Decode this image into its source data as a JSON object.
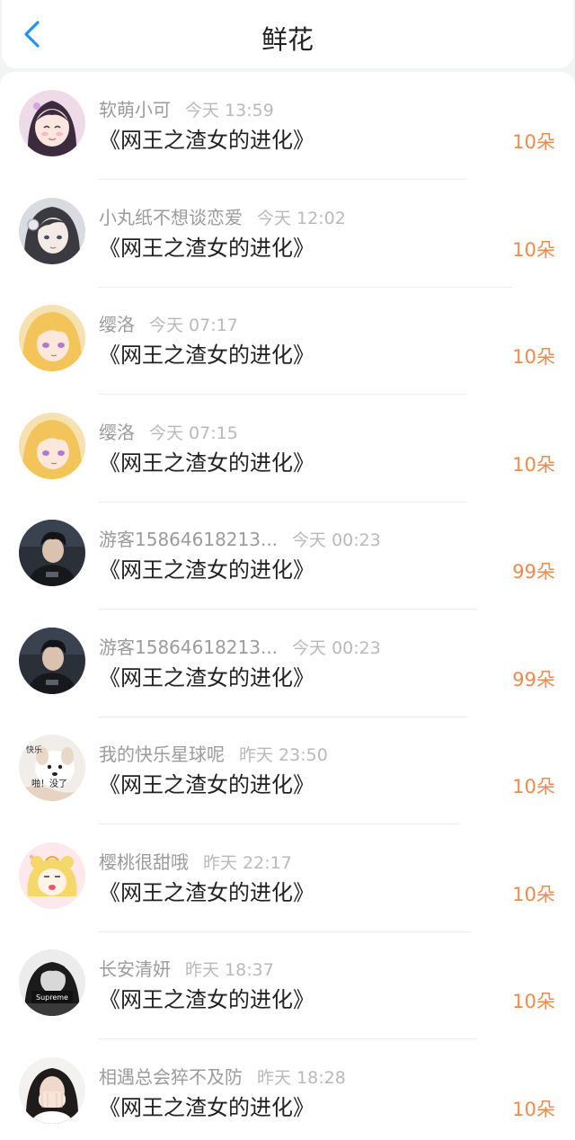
{
  "header": {
    "title": "鲜花",
    "back_icon": "chevron-left-icon",
    "accent_color": "#1e96f0"
  },
  "list": {
    "items": [
      {
        "name": "软萌小可",
        "time": "今天 13:59",
        "book": "《网王之渣女的进化》",
        "count": "10朵",
        "avatar": "anime-girl-purple"
      },
      {
        "name": "小丸纸不想谈恋爱",
        "time": "今天 12:02",
        "book": "《网王之渣女的进化》",
        "count": "10朵",
        "avatar": "anime-girl-dark-hair"
      },
      {
        "name": "缨洛",
        "time": "今天 07:17",
        "book": "《网王之渣女的进化》",
        "count": "10朵",
        "avatar": "anime-blonde"
      },
      {
        "name": "缨洛",
        "time": "今天 07:15",
        "book": "《网王之渣女的进化》",
        "count": "10朵",
        "avatar": "anime-blonde"
      },
      {
        "name": "游客15864618213...",
        "time": "今天 00:23",
        "book": "《网王之渣女的进化》",
        "count": "99朵",
        "avatar": "photo-boy-dark"
      },
      {
        "name": "游客15864618213...",
        "time": "今天 00:23",
        "book": "《网王之渣女的进化》",
        "count": "99朵",
        "avatar": "photo-boy-dark"
      },
      {
        "name": "我的快乐星球呢",
        "time": "昨天 23:50",
        "book": "《网王之渣女的进化》",
        "count": "10朵",
        "avatar": "meme-dog",
        "avatar_text_1": "快乐",
        "avatar_text_2": "啪！没了"
      },
      {
        "name": "樱桃很甜哦",
        "time": "昨天 22:17",
        "book": "《网王之渣女的进化》",
        "count": "10朵",
        "avatar": "cartoon-sailor-moon"
      },
      {
        "name": "长安清妍",
        "time": "昨天 18:37",
        "book": "《网王之渣女的进化》",
        "count": "10朵",
        "avatar": "photo-bw-girl",
        "avatar_text_1": "Supreme"
      },
      {
        "name": "相遇总会猝不及防",
        "time": "昨天 18:28",
        "book": "《网王之渣女的进化》",
        "count": "10朵",
        "avatar": "photo-girl-hands"
      }
    ]
  }
}
